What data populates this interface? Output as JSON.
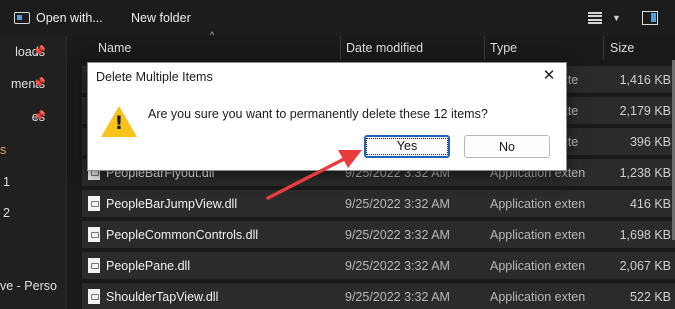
{
  "toolbar": {
    "open_with": "Open with...",
    "new_folder": "New folder",
    "view_icon": "details-view-icon",
    "caret_icon": "chevron-down-icon",
    "pane_icon": "preview-pane-icon"
  },
  "nav": {
    "items": [
      {
        "label": "loads",
        "pinned": true
      },
      {
        "label": "ments",
        "pinned": true
      },
      {
        "label": "es",
        "pinned": true
      },
      {
        "label": "s",
        "pinned": false
      },
      {
        "label": "1",
        "pinned": false
      },
      {
        "label": "2",
        "pinned": false
      },
      {
        "label": "ve - Perso",
        "pinned": false
      }
    ]
  },
  "columns": {
    "name": "Name",
    "date": "Date modified",
    "type": "Type",
    "size": "Size"
  },
  "files": [
    {
      "name": "",
      "date": "",
      "type": "Application exte",
      "size": "1,416 KB"
    },
    {
      "name": "",
      "date": "",
      "type": "Application exte",
      "size": "2,179 KB"
    },
    {
      "name": "",
      "date": "",
      "type": "Application exte",
      "size": "396 KB"
    },
    {
      "name": "PeopleBarFlyout.dll",
      "date": "9/25/2022 3:32 AM",
      "type": "Application exten",
      "size": "1,238 KB"
    },
    {
      "name": "PeopleBarJumpView.dll",
      "date": "9/25/2022 3:32 AM",
      "type": "Application exten",
      "size": "416 KB"
    },
    {
      "name": "PeopleCommonControls.dll",
      "date": "9/25/2022 3:32 AM",
      "type": "Application exten",
      "size": "1,698 KB"
    },
    {
      "name": "PeoplePane.dll",
      "date": "9/25/2022 3:32 AM",
      "type": "Application exten",
      "size": "2,067 KB"
    },
    {
      "name": "ShoulderTapView.dll",
      "date": "9/25/2022 3:32 AM",
      "type": "Application exten",
      "size": "522 KB"
    }
  ],
  "dialog": {
    "title": "Delete Multiple Items",
    "message": "Are you sure you want to permanently delete these 12 items?",
    "yes": "Yes",
    "no": "No",
    "close_glyph": "✕",
    "icon": "warning-icon"
  },
  "colors": {
    "annotation_arrow": "#e83c3c",
    "warning": "#f8c31a",
    "accent": "#1d64b7"
  }
}
